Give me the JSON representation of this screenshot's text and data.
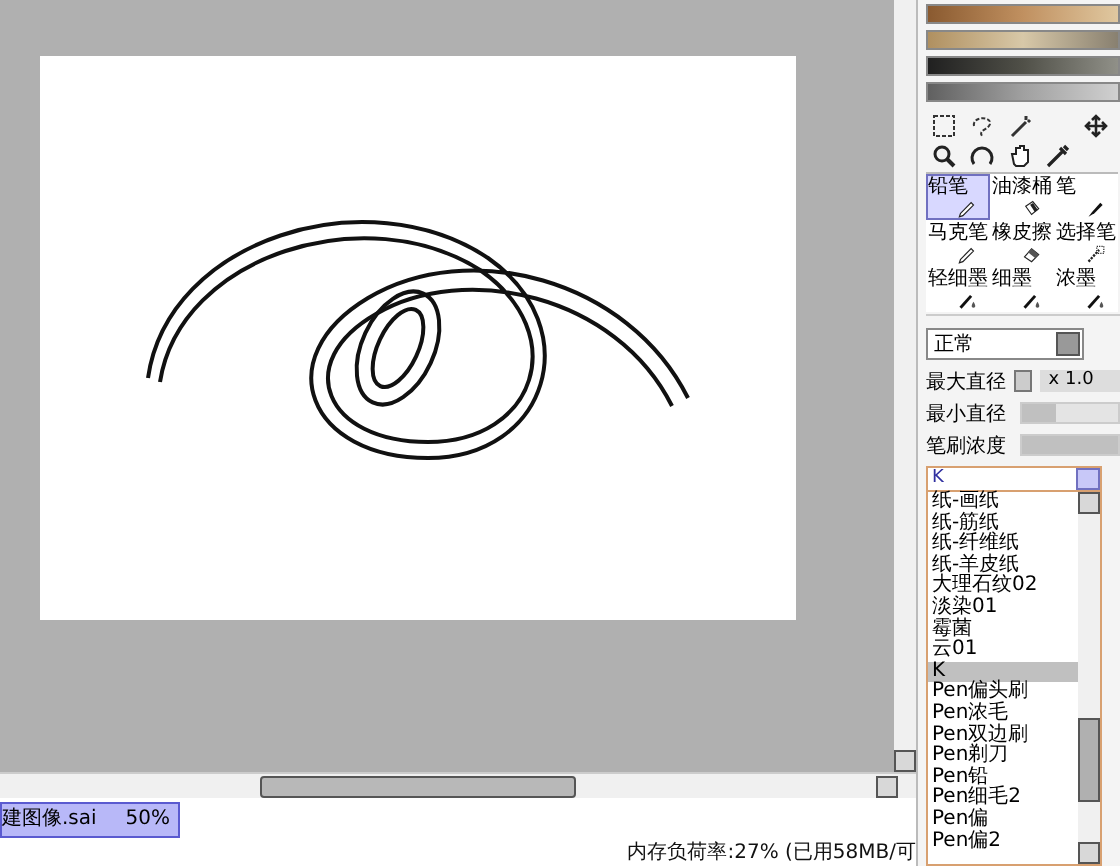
{
  "document_tab": {
    "name": "建图像.sai",
    "zoom": "50%",
    "selected": true
  },
  "status_bar": {
    "memory": "内存负荷率:27% (已用58MB/可"
  },
  "tools": [
    {
      "label": "铅笔",
      "kind": "pencil",
      "selected": true
    },
    {
      "label": "油漆桶",
      "kind": "bucket",
      "selected": false
    },
    {
      "label": "笔",
      "kind": "pen",
      "selected": false
    },
    {
      "label": "马克笔",
      "kind": "pencil",
      "selected": false
    },
    {
      "label": "橡皮擦",
      "kind": "eraser",
      "selected": false
    },
    {
      "label": "选择笔",
      "kind": "dots",
      "selected": false
    },
    {
      "label": "轻细墨",
      "kind": "ink",
      "selected": false
    },
    {
      "label": "细墨",
      "kind": "ink",
      "selected": false
    },
    {
      "label": "浓墨",
      "kind": "ink",
      "selected": false
    }
  ],
  "brush": {
    "blend_mode": "正常",
    "params": [
      {
        "label": "最大直径",
        "kind": "value",
        "value": "x 1.0"
      },
      {
        "label": "最小直径",
        "kind": "slider",
        "level": 0.35
      },
      {
        "label": "笔刷浓度",
        "kind": "slider",
        "level": 1
      }
    ]
  },
  "texture_list": {
    "value": "K",
    "items": [
      {
        "label": "纸-画纸",
        "selected": false
      },
      {
        "label": "纸-筋纸",
        "selected": false
      },
      {
        "label": "纸-纤维纸",
        "selected": false
      },
      {
        "label": "纸-羊皮纸",
        "selected": false
      },
      {
        "label": "大理石纹02",
        "selected": false
      },
      {
        "label": "淡染01",
        "selected": false
      },
      {
        "label": "霉菌",
        "selected": false
      },
      {
        "label": "云01",
        "selected": false
      },
      {
        "label": "K",
        "selected": true
      },
      {
        "label": "Pen偏头刷",
        "selected": false
      },
      {
        "label": "Pen浓毛",
        "selected": false
      },
      {
        "label": "Pen双边刷",
        "selected": false
      },
      {
        "label": "Pen剃刀",
        "selected": false
      },
      {
        "label": "Pen铅",
        "selected": false
      },
      {
        "label": "Pen细毛2",
        "selected": false
      },
      {
        "label": "Pen偏",
        "selected": false
      },
      {
        "label": "Pen偏2",
        "selected": false
      }
    ]
  }
}
